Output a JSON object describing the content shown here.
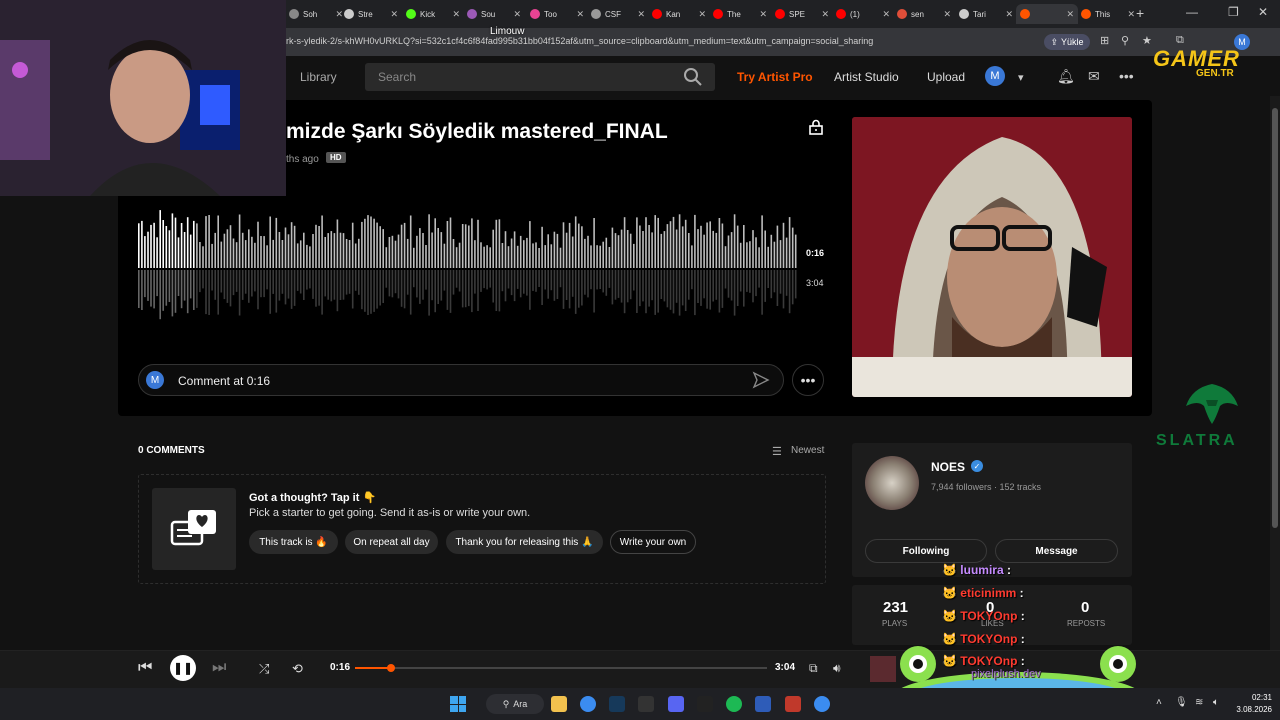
{
  "browser": {
    "tabs": [
      {
        "label": "Soh",
        "color": "#888888"
      },
      {
        "label": "Stre",
        "color": "#cccccc"
      },
      {
        "label": "Kick",
        "color": "#53fc18"
      },
      {
        "label": "Sou",
        "color": "#9b59b6"
      },
      {
        "label": "Too",
        "color": "#e84393"
      },
      {
        "label": "CSF",
        "color": "#999999"
      },
      {
        "label": "Kan",
        "color": "#ff0000"
      },
      {
        "label": "The",
        "color": "#ff0000"
      },
      {
        "label": "SPE",
        "color": "#ff0000"
      },
      {
        "label": "(1)",
        "color": "#ff0000"
      },
      {
        "label": "sen",
        "color": "#e04e39"
      },
      {
        "label": "Tari",
        "color": "#cccccc"
      },
      {
        "label": "",
        "color": "#ff5500"
      },
      {
        "label": "This",
        "color": "#ff5500"
      }
    ],
    "url": "rk-s-yledik-2/s-khWH0vURKLQ?si=532c1cf4c6f84fad995b31bb04f152af&utm_source=clipboard&utm_medium=text&utm_campaign=social_sharing",
    "upload_button": "Yükle",
    "profile_initial": "M"
  },
  "header": {
    "library": "Library",
    "search_placeholder": "Search",
    "try_artist_pro": "Try Artist Pro",
    "artist_studio": "Artist Studio",
    "upload": "Upload",
    "avatar_initial": "M"
  },
  "overlay_logos": {
    "gamer": "GAMER",
    "gen": "GEN.TR",
    "slatra": "SLATRA",
    "webcam_name": "Limouw"
  },
  "track": {
    "title": "mizde Şarkı Söyledik mastered_FINAL",
    "posted": "ths ago",
    "hd_badge": "HD",
    "current_time": "0:16",
    "duration": "3:04",
    "progress": 0.087,
    "comment_avatar": "M",
    "comment_placeholder": "Comment at 0:16"
  },
  "comments": {
    "count_label": "0 COMMENTS",
    "sort_label": "Newest",
    "prompt_title": "Got a thought? Tap it 👇",
    "prompt_sub": "Pick a starter to get going. Send it as-is or write your own.",
    "chips": [
      "This track is 🔥",
      "On repeat all day",
      "Thank you for releasing this 🙏",
      "Write your own"
    ]
  },
  "artist": {
    "name": "NOES",
    "stats": "7,944 followers · 152 tracks",
    "following_label": "Following",
    "message_label": "Message",
    "plays_value": "231",
    "plays_label": "PLAYS",
    "likes_value": "0",
    "likes_label": "LIKES",
    "reposts_value": "0",
    "reposts_label": "REPOSTS"
  },
  "player": {
    "current_time": "0:16",
    "duration": "3:04",
    "progress": 0.087
  },
  "chat": [
    {
      "user": "luumira",
      "color": "#c58bff"
    },
    {
      "user": "eticinimm",
      "color": "#ff3b30"
    },
    {
      "user": "TOKYOnp",
      "color": "#ff3b30"
    },
    {
      "user": "TOKYOnp",
      "color": "#ff3b30"
    },
    {
      "user": "TOKYOnp",
      "color": "#ff3b30"
    }
  ],
  "chat_widget": "pixelplush.dev",
  "taskbar": {
    "search_label": "Ara",
    "time": "02:31",
    "date": "3.08.2026"
  },
  "colors": {
    "accent": "#ff5500",
    "background": "#121212"
  }
}
